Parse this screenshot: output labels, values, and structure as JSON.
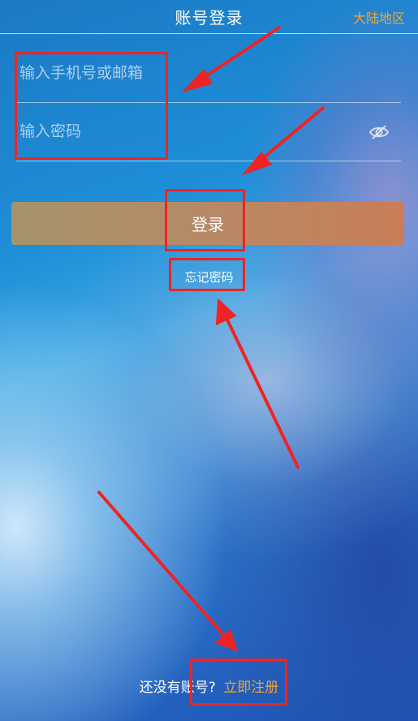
{
  "header": {
    "title": "账号登录",
    "region": "大陆地区"
  },
  "form": {
    "account_placeholder": "输入手机号或邮箱",
    "password_placeholder": "输入密码",
    "password_toggle_icon": "eye-off-icon",
    "login_label": "登录",
    "forgot_label": "忘记密码"
  },
  "footer": {
    "no_account_text": "还没有账号?",
    "register_label": "立即注册"
  },
  "colors": {
    "accent": "#f2a533",
    "button": "#b68a66",
    "annotation": "#ee2424"
  }
}
